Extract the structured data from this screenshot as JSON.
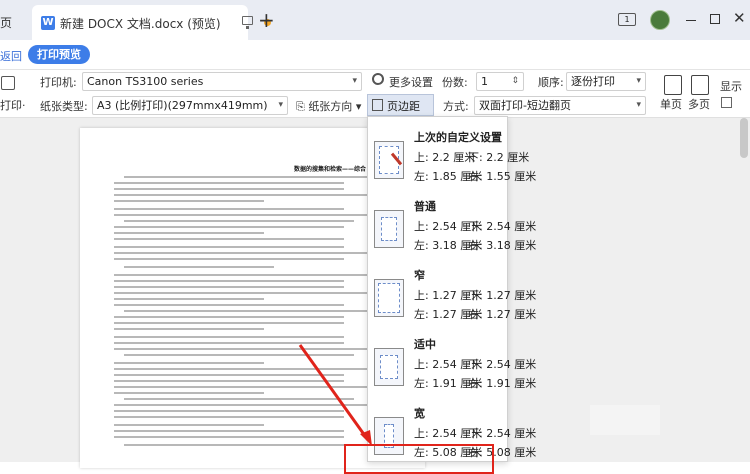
{
  "tabs": {
    "home_label": "页",
    "doc_title": "新建 DOCX 文档.docx  (预览)",
    "doc_icon": "W"
  },
  "subbar": {
    "back_label": "返回",
    "preview_label": "打印预览"
  },
  "toolbar": {
    "print_label": "打印·",
    "printer_label": "打印机:",
    "printer_value": "Canon TS3100 series",
    "more_settings": "更多设置",
    "copies_label": "份数:",
    "copies_value": "1",
    "order_label": "顺序:",
    "order_value": "逐份打印",
    "paper_label": "纸张类型:",
    "paper_value": "A3 (比例打印)(297mmx419mm)",
    "orientation_label": "纸张方向",
    "margin_label": "页边距",
    "mode_label": "方式:",
    "mode_value": "双面打印-短边翻页",
    "single_page": "单页",
    "multi_page": "多页",
    "display_label": "显示"
  },
  "document": {
    "heading": "数据的搜集和检索——综合"
  },
  "margin_presets": [
    {
      "title": "上次的自定义设置",
      "top": "上: 2.2 厘米",
      "bottom": "下: 2.2 厘米",
      "left": "左: 1.85 厘米",
      "right": "右: 1.55 厘米"
    },
    {
      "title": "普通",
      "top": "上: 2.54 厘米",
      "bottom": "下: 2.54 厘米",
      "left": "左: 3.18 厘米",
      "right": "右: 3.18 厘米"
    },
    {
      "title": "窄",
      "top": "上: 1.27 厘米",
      "bottom": "下: 1.27 厘米",
      "left": "左: 1.27 厘米",
      "right": "右: 1.27 厘米"
    },
    {
      "title": "适中",
      "top": "上: 2.54 厘米",
      "bottom": "下: 2.54 厘米",
      "left": "左: 1.91 厘米",
      "right": "右: 1.91 厘米"
    },
    {
      "title": "宽",
      "top": "上: 2.54 厘米",
      "bottom": "下: 2.54 厘米",
      "left": "左: 5.08 厘米",
      "right": "右: 5.08 厘米"
    }
  ],
  "colors": {
    "accent": "#3d7de8",
    "annotation": "#e0241b"
  }
}
